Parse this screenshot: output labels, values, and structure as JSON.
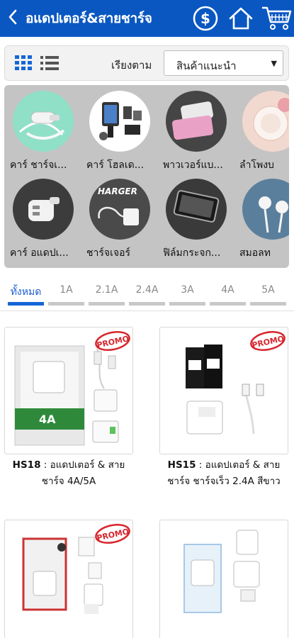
{
  "header": {
    "title": "อแดปเตอร์&สายชาร์จ",
    "icons": [
      "back-icon",
      "currency-icon",
      "home-icon",
      "cart-icon"
    ],
    "color": "#0a57c2"
  },
  "toolbar": {
    "sort_label": "เรียงตาม",
    "sort_value": "สินค้าแนะนำ"
  },
  "categories": [
    {
      "label": "คาร์ ชาร์จเ..."
    },
    {
      "label": "คาร์ โฮลเด..."
    },
    {
      "label": "พาวเวอร์แบ..."
    },
    {
      "label": "ลำโพงบ"
    },
    {
      "label": "คาร์ อแดปเ..."
    },
    {
      "label": "ชาร์จเจอร์"
    },
    {
      "label": "ฟิล์มกระจก..."
    },
    {
      "label": "สมอลท"
    }
  ],
  "tabs": [
    {
      "label": "ทั้งหมด"
    },
    {
      "label": "1A"
    },
    {
      "label": "2.1A"
    },
    {
      "label": "2.4A"
    },
    {
      "label": "3A"
    },
    {
      "label": "4A"
    },
    {
      "label": "5A"
    }
  ],
  "products": [
    {
      "code": "HS18",
      "name": " : อแดปเตอร์ & สาย ชาร์จ 4A/5A",
      "badge": "PROMO"
    },
    {
      "code": "HS15",
      "name": " : อแดปเตอร์ & สาย ชาร์จ ชาร์จเร็ว 2.4A สีขาว",
      "badge": "PROMO"
    },
    {
      "code": "",
      "name": "",
      "badge": "PROMO"
    },
    {
      "code": "",
      "name": "",
      "badge": ""
    }
  ],
  "colors": {
    "accent": "#1565d8",
    "promo": "#d7262d"
  }
}
